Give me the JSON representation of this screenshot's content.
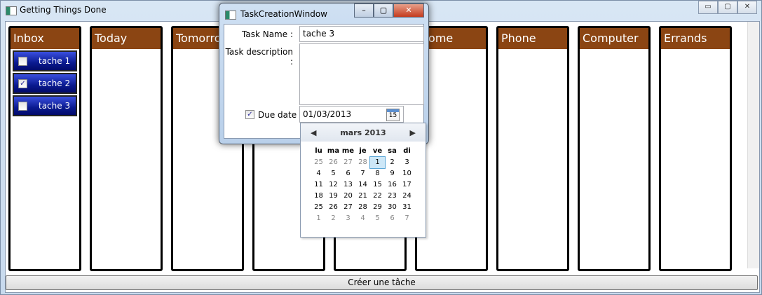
{
  "app": {
    "title": "Getting Things Done",
    "create_button": "Créer une tâche"
  },
  "columns": [
    {
      "title": "Inbox",
      "tasks": [
        {
          "name": "tache 1",
          "done": false
        },
        {
          "name": "tache 2",
          "done": true
        },
        {
          "name": "tache 3",
          "done": false
        }
      ]
    },
    {
      "title": "Today",
      "tasks": []
    },
    {
      "title": "Tomorrow",
      "tasks": []
    },
    {
      "title": "",
      "tasks": []
    },
    {
      "title": "",
      "tasks": []
    },
    {
      "title": "Home",
      "tasks": []
    },
    {
      "title": "Phone",
      "tasks": []
    },
    {
      "title": "Computer",
      "tasks": []
    },
    {
      "title": "Errands",
      "tasks": []
    }
  ],
  "dialog": {
    "title": "TaskCreationWindow",
    "task_name_label": "Task Name :",
    "task_name_value": "tache 3",
    "description_label": "Task description :",
    "description_value": "",
    "due_date_label": "Due date :",
    "due_date_checked": true,
    "due_date_value": "01/03/2013"
  },
  "calendar": {
    "month": "mars 2013",
    "weekdays": [
      "lu",
      "ma",
      "me",
      "je",
      "ve",
      "sa",
      "di"
    ],
    "days": [
      "25",
      "26",
      "27",
      "28",
      "1",
      "2",
      "3",
      "4",
      "5",
      "6",
      "7",
      "8",
      "9",
      "10",
      "11",
      "12",
      "13",
      "14",
      "15",
      "16",
      "17",
      "18",
      "19",
      "20",
      "21",
      "22",
      "23",
      "24",
      "25",
      "26",
      "27",
      "28",
      "29",
      "30",
      "31",
      "1",
      "2",
      "3",
      "4",
      "5",
      "6",
      "7"
    ],
    "selected": "1"
  }
}
